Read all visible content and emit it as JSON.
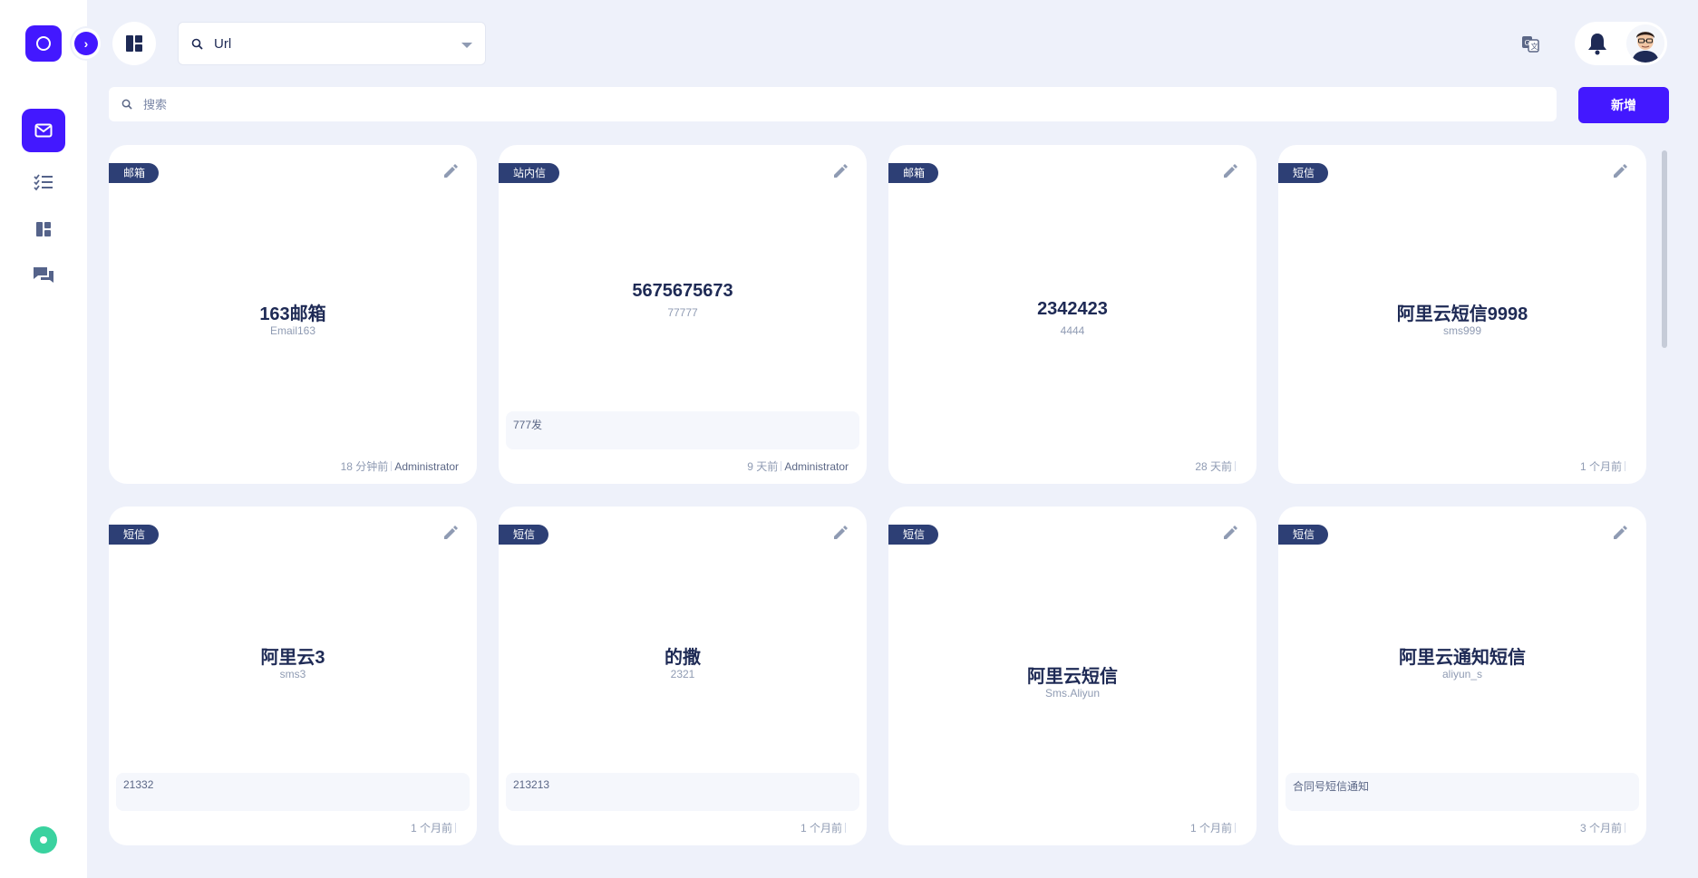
{
  "header": {
    "url_select_value": "Url",
    "search_placeholder": "搜索",
    "add_button_label": "新增"
  },
  "sidebar": {
    "items": [
      {
        "icon": "mail-icon",
        "active": true
      },
      {
        "icon": "checklist-icon",
        "active": false
      },
      {
        "icon": "dashboard-icon",
        "active": false
      },
      {
        "icon": "chat-icon",
        "active": false
      }
    ]
  },
  "colors": {
    "accent": "#4318ff",
    "badge": "#2d3f75",
    "background": "#eef1fa",
    "status": "#3ad29f"
  },
  "cards": [
    {
      "badge": "邮箱",
      "title": "163邮箱",
      "subtitle": "Email163",
      "note": "",
      "time": "18 分钟前",
      "user": "Administrator"
    },
    {
      "badge": "站内信",
      "title": "5675675673",
      "subtitle": "77777",
      "note": "777发",
      "time": "9 天前",
      "user": "Administrator"
    },
    {
      "badge": "邮箱",
      "title": "2342423",
      "subtitle": "4444",
      "note": "",
      "time": "28 天前",
      "user": ""
    },
    {
      "badge": "短信",
      "title": "阿里云短信9998",
      "subtitle": "sms999",
      "note": "",
      "time": "1 个月前",
      "user": ""
    },
    {
      "badge": "短信",
      "title": "阿里云3",
      "subtitle": "sms3",
      "note": "21332",
      "time": "1 个月前",
      "user": ""
    },
    {
      "badge": "短信",
      "title": "的撒",
      "subtitle": "2321",
      "note": "213213",
      "time": "1 个月前",
      "user": ""
    },
    {
      "badge": "短信",
      "title": "阿里云短信",
      "subtitle": "Sms.Aliyun",
      "note": "",
      "time": "1 个月前",
      "user": ""
    },
    {
      "badge": "短信",
      "title": "阿里云通知短信",
      "subtitle": "aliyun_s",
      "note": "合同号短信通知",
      "time": "3 个月前",
      "user": ""
    }
  ]
}
